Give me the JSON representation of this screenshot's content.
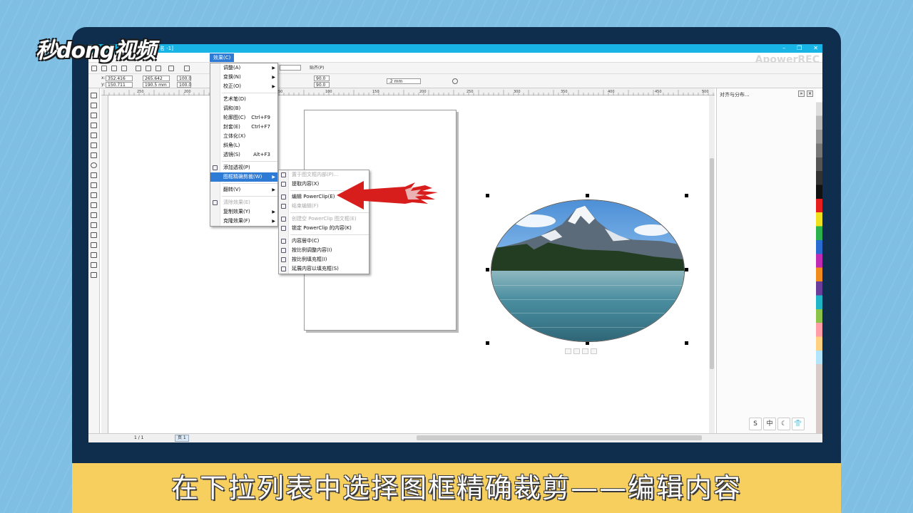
{
  "branding": {
    "logo_text": "秒dong视频"
  },
  "window": {
    "title_fragment": "名 -1]",
    "watermark": "ApowerREC",
    "minimize": "–",
    "restore": "❐",
    "close": "✕"
  },
  "menubar": {
    "active_menu": "效果(C)"
  },
  "toolbar": {
    "snap_label": "贴齐(P)",
    "x_value": "352.416 mm",
    "y_value": "150.711 mm",
    "w_value": "265.642 mm",
    "h_value": "190.5 mm",
    "scale_x": "100.0",
    "scale_y": "100.0",
    "angle_1": "90.0",
    "angle_2": "90.0",
    "outline": ".2 mm"
  },
  "ruler": {
    "ticks": [
      "250",
      "200",
      "150",
      "50",
      "100",
      "150",
      "200",
      "250",
      "300",
      "350",
      "400",
      "450",
      "500"
    ]
  },
  "effects_menu": {
    "items": [
      {
        "label": "调整(A)",
        "submenu": true
      },
      {
        "label": "变换(N)",
        "submenu": true
      },
      {
        "label": "校正(O)",
        "submenu": true
      },
      {
        "sep": true
      },
      {
        "label": "艺术笔(D)"
      },
      {
        "label": "调和(B)"
      },
      {
        "label": "轮廓图(C)",
        "shortcut": "Ctrl+F9"
      },
      {
        "label": "封套(E)",
        "shortcut": "Ctrl+F7"
      },
      {
        "label": "立体化(X)"
      },
      {
        "label": "斜角(L)"
      },
      {
        "label": "透镜(S)",
        "shortcut": "Alt+F3"
      },
      {
        "sep": true
      },
      {
        "label": "添加透视(P)",
        "icon": true
      },
      {
        "label": "图框精确剪裁(W)",
        "submenu": true,
        "selected": true
      },
      {
        "sep": true
      },
      {
        "label": "翻转(V)",
        "submenu": true
      },
      {
        "sep": true
      },
      {
        "label": "清除效果(E)",
        "disabled": true,
        "icon": true
      },
      {
        "label": "复制效果(Y)",
        "submenu": true
      },
      {
        "label": "克隆效果(F)",
        "submenu": true
      }
    ]
  },
  "powerclip_menu": {
    "items": [
      {
        "label": "置于图文框内部(P)...",
        "disabled": true,
        "icon": true
      },
      {
        "label": "提取内容(X)",
        "icon": true
      },
      {
        "sep": true
      },
      {
        "label": "编辑 PowerClip(E)",
        "icon": true
      },
      {
        "label": "结束编辑(F)",
        "disabled": true,
        "icon": true
      },
      {
        "sep": true
      },
      {
        "label": "创建空 PowerClip 图文框(E)",
        "disabled": true,
        "icon": true
      },
      {
        "label": "锁定 PowerClip 的内容(K)",
        "icon": true
      },
      {
        "sep": true
      },
      {
        "label": "内容居中(C)",
        "icon": true
      },
      {
        "label": "按比例调整内容(I)",
        "icon": true
      },
      {
        "label": "按比例填充框(I)",
        "icon": true
      },
      {
        "label": "延展内容以填充框(S)",
        "icon": true
      }
    ]
  },
  "docker": {
    "title": "对齐与分布..."
  },
  "statusbar": {
    "page_counter": "1 / 1",
    "page_tab": "页 1"
  },
  "ime": {
    "buttons": [
      "S",
      "中",
      "☾",
      "👕"
    ]
  },
  "subtitle": {
    "text": "在下拉列表中选择图框精确裁剪——编辑内容"
  },
  "colors": {
    "accent": "#2e7bd6",
    "arrow": "#d81d1d",
    "subtitle_bg": "#f6cf5e",
    "frame": "#0f2e4d"
  }
}
